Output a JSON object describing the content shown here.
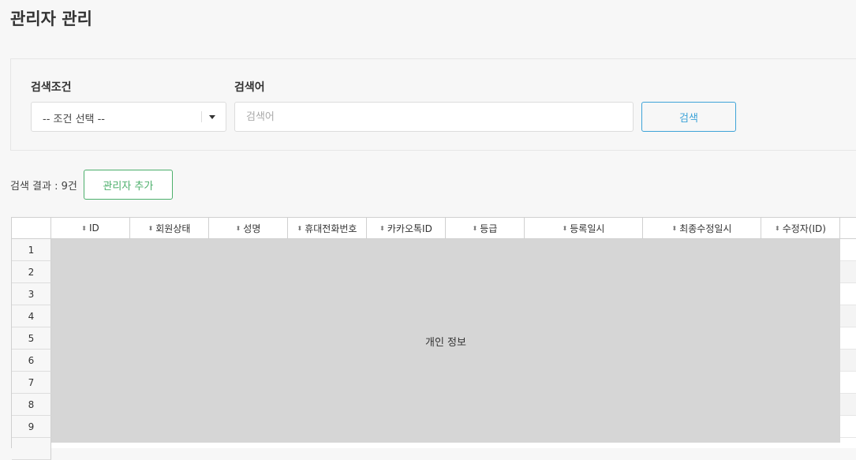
{
  "page": {
    "title": "관리자 관리"
  },
  "search": {
    "condition_label": "검색조건",
    "condition_value": "-- 조건 선택 --",
    "keyword_label": "검색어",
    "keyword_placeholder": "검색어",
    "keyword_value": "",
    "button_label": "검색"
  },
  "results": {
    "count_text": "검색 결과 : 9건",
    "add_button_label": "관리자 추가"
  },
  "grid": {
    "columns": [
      "ID",
      "회원상태",
      "성명",
      "휴대전화번호",
      "카카오톡ID",
      "등급",
      "등록일시",
      "최종수정일시",
      "수정자(ID)"
    ],
    "row_numbers": [
      "1",
      "2",
      "3",
      "4",
      "5",
      "6",
      "7",
      "8",
      "9"
    ],
    "mask_text": "개인 정보"
  },
  "colors": {
    "accent_blue": "#3ea3d8",
    "accent_green": "#4caf6b"
  },
  "icons": {
    "sort": "sort-updown-icon",
    "dropdown": "chevron-down-icon"
  }
}
